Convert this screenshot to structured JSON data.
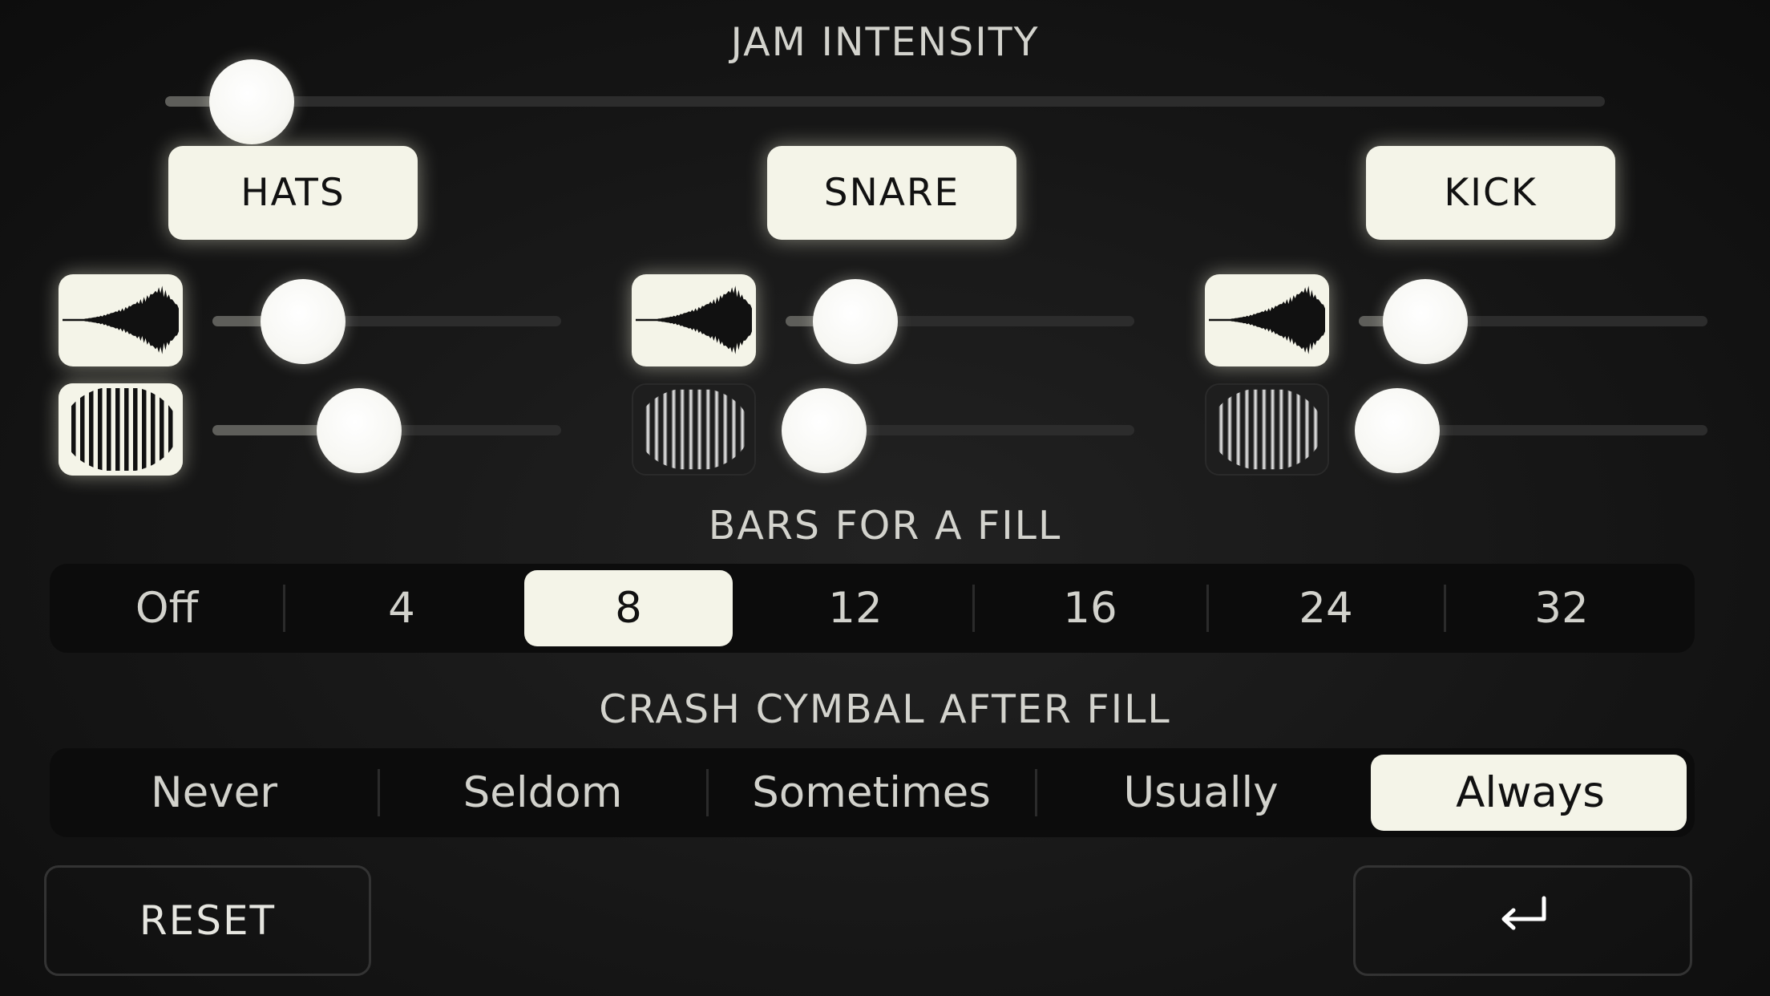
{
  "jam_intensity": {
    "title": "JAM INTENSITY",
    "value": 0.06
  },
  "drums": [
    {
      "label": "HATS",
      "volume": 0.26,
      "pattern_enabled": true,
      "pattern_level": 0.42
    },
    {
      "label": "SNARE",
      "volume": 0.2,
      "pattern_enabled": false,
      "pattern_level": 0.11
    },
    {
      "label": "KICK",
      "volume": 0.19,
      "pattern_enabled": false,
      "pattern_level": 0.11
    }
  ],
  "icons": {
    "volume": "waveform-icon",
    "pattern": "striped-drum-icon",
    "enter": "return-arrow-icon"
  },
  "bars_for_fill": {
    "title": "BARS FOR A FILL",
    "options": [
      "Off",
      "4",
      "8",
      "12",
      "16",
      "24",
      "32"
    ],
    "selected": "8"
  },
  "crash_after_fill": {
    "title": "CRASH CYMBAL AFTER FILL",
    "options": [
      "Never",
      "Seldom",
      "Sometimes",
      "Usually",
      "Always"
    ],
    "selected": "Always"
  },
  "buttons": {
    "reset": "RESET"
  },
  "colors": {
    "accent": "#f4f4e8",
    "background": "#161616",
    "track": "#2c2c2c"
  }
}
